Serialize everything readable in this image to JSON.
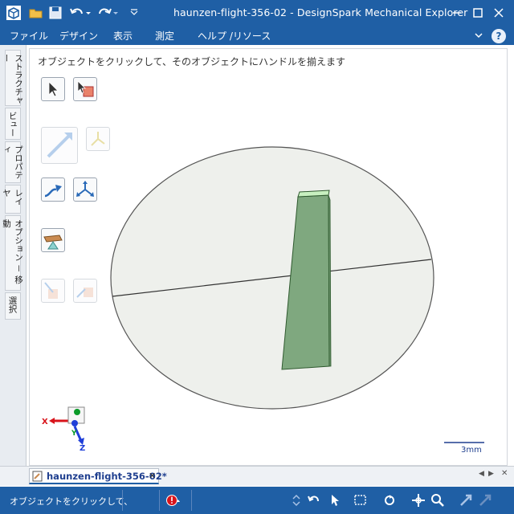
{
  "window": {
    "title": "haunzen-flight-356-02 - DesignSpark Mechanical Explorer"
  },
  "menu": {
    "items": [
      "ファイル",
      "デザイン",
      "表示",
      "測定",
      "ヘルプ /リソース"
    ],
    "help_label": "?"
  },
  "side_tabs": [
    "ストラクチャー",
    "ビュー",
    "プロパティ",
    "レイヤ",
    "オプション － 移動",
    "選択"
  ],
  "viewport": {
    "hint": "オブジェクトをクリックして、そのオブジェクトにハンドルを揃えます",
    "axis_labels": {
      "x": "X",
      "y": "Y",
      "z": "Z"
    },
    "scale_label": "3mm",
    "colors": {
      "disc_fill": "#eef0ec",
      "part_fill": "#7fa87f",
      "part_top": "#c8f0c0",
      "axis_x": "#d8141b",
      "axis_y": "#0a9a28",
      "axis_z": "#1f3fd8"
    }
  },
  "document_tab": {
    "label": "haunzen-flight-356-02*",
    "close": "✕"
  },
  "status": {
    "text": "オブジェクトをクリックして、"
  }
}
